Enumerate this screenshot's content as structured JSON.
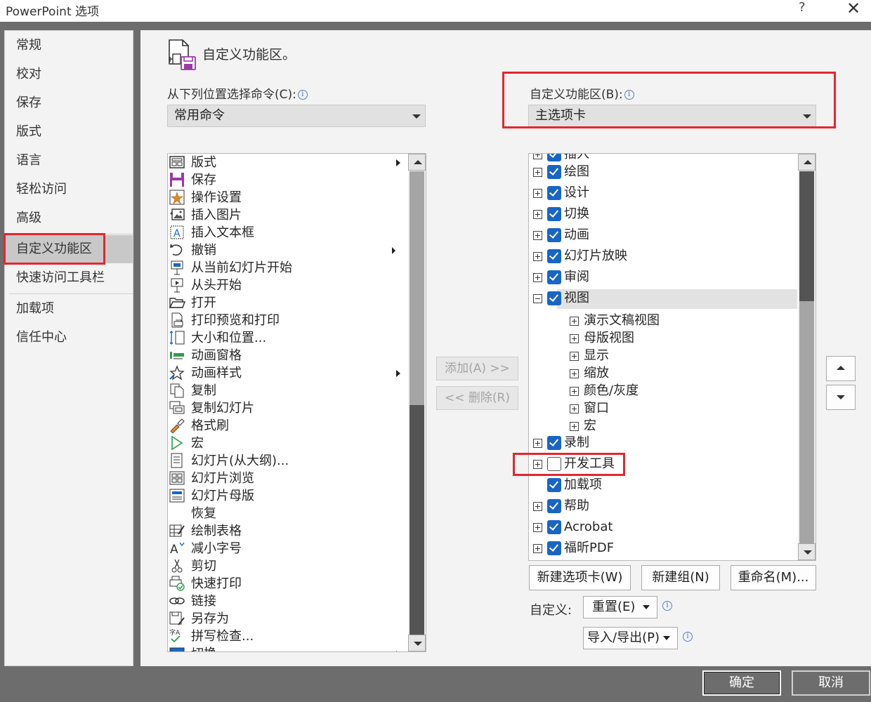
{
  "window": {
    "title": "PowerPoint 选项",
    "help": "?",
    "close": "✕"
  },
  "sidebar": {
    "items": [
      {
        "label": "常规"
      },
      {
        "label": "校对"
      },
      {
        "label": "保存"
      },
      {
        "label": "版式"
      },
      {
        "label": "语言"
      },
      {
        "label": "轻松访问"
      },
      {
        "label": "高级"
      },
      {
        "label": "自定义功能区",
        "active": true
      },
      {
        "label": "快速访问工具栏"
      },
      {
        "label": "加载项"
      },
      {
        "label": "信任中心"
      }
    ]
  },
  "main": {
    "title": "自定义功能区。",
    "choose_label": "从下列位置选择命令(C):",
    "choose_value": "常用命令",
    "customize_label": "自定义功能区(B):",
    "customize_value": "主选项卡",
    "commands": [
      {
        "label": "版式",
        "icon": "layout-icon",
        "submenu": true
      },
      {
        "label": "保存",
        "icon": "save-icon"
      },
      {
        "label": "操作设置",
        "icon": "action-star-icon"
      },
      {
        "label": "插入图片",
        "icon": "picture-icon"
      },
      {
        "label": "插入文本框",
        "icon": "textbox-icon"
      },
      {
        "label": "撤销",
        "icon": "undo-icon"
      },
      {
        "label": "从当前幻灯片开始",
        "icon": "present-current-icon"
      },
      {
        "label": "从头开始",
        "icon": "present-start-icon"
      },
      {
        "label": "打开",
        "icon": "folder-open-icon"
      },
      {
        "label": "打印预览和打印",
        "icon": "print-preview-icon"
      },
      {
        "label": "大小和位置...",
        "icon": "size-position-icon"
      },
      {
        "label": "动画窗格",
        "icon": "animation-pane-icon"
      },
      {
        "label": "动画样式",
        "icon": "animation-style-icon",
        "submenu": true
      },
      {
        "label": "复制",
        "icon": "copy-icon"
      },
      {
        "label": "复制幻灯片",
        "icon": "duplicate-slide-icon"
      },
      {
        "label": "格式刷",
        "icon": "format-painter-icon"
      },
      {
        "label": "宏",
        "icon": "macro-play-icon"
      },
      {
        "label": "幻灯片(从大纲)...",
        "icon": "outline-slides-icon"
      },
      {
        "label": "幻灯片浏览",
        "icon": "slide-sorter-icon"
      },
      {
        "label": "幻灯片母版",
        "icon": "slide-master-icon"
      },
      {
        "label": "恢复",
        "icon": "blank-icon"
      },
      {
        "label": "绘制表格",
        "icon": "draw-table-icon"
      },
      {
        "label": "减小字号",
        "icon": "decrease-font-icon"
      },
      {
        "label": "剪切",
        "icon": "scissors-icon"
      },
      {
        "label": "快速打印",
        "icon": "quick-print-icon"
      },
      {
        "label": "链接",
        "icon": "link-icon"
      },
      {
        "label": "另存为",
        "icon": "save-as-icon"
      },
      {
        "label": "拼写检查...",
        "icon": "spelling-icon"
      },
      {
        "label": "切换",
        "icon": "switch-icon"
      }
    ],
    "add_button": "添加(A) >>",
    "remove_button": "<< 删除(R)",
    "ribbon_tree": [
      {
        "label": "插入",
        "level": 0,
        "expander": "plus",
        "checked": true
      },
      {
        "label": "绘图",
        "level": 0,
        "expander": "plus",
        "checked": true
      },
      {
        "label": "设计",
        "level": 0,
        "expander": "plus",
        "checked": true
      },
      {
        "label": "切换",
        "level": 0,
        "expander": "plus",
        "checked": true
      },
      {
        "label": "动画",
        "level": 0,
        "expander": "plus",
        "checked": true
      },
      {
        "label": "幻灯片放映",
        "level": 0,
        "expander": "plus",
        "checked": true
      },
      {
        "label": "审阅",
        "level": 0,
        "expander": "plus",
        "checked": true
      },
      {
        "label": "视图",
        "level": 0,
        "expander": "minus",
        "checked": true,
        "selected": true
      },
      {
        "label": "演示文稿视图",
        "level": 1,
        "expander": "plus"
      },
      {
        "label": "母版视图",
        "level": 1,
        "expander": "plus"
      },
      {
        "label": "显示",
        "level": 1,
        "expander": "plus"
      },
      {
        "label": "缩放",
        "level": 1,
        "expander": "plus"
      },
      {
        "label": "颜色/灰度",
        "level": 1,
        "expander": "plus"
      },
      {
        "label": "窗口",
        "level": 1,
        "expander": "plus"
      },
      {
        "label": "宏",
        "level": 1,
        "expander": "plus"
      },
      {
        "label": "录制",
        "level": 0,
        "expander": "plus",
        "checked": true
      },
      {
        "label": "开发工具",
        "level": 0,
        "expander": "plus",
        "checked": false
      },
      {
        "label": "加载项",
        "level": 0,
        "expander": "none",
        "checked": true
      },
      {
        "label": "帮助",
        "level": 0,
        "expander": "plus",
        "checked": true
      },
      {
        "label": "Acrobat",
        "level": 0,
        "expander": "plus",
        "checked": true
      },
      {
        "label": "福昕PDF",
        "level": 0,
        "expander": "plus",
        "checked": true
      }
    ],
    "new_tab_button": "新建选项卡(W)",
    "new_group_button": "新建组(N)",
    "rename_button": "重命名(M)...",
    "customizations_label": "自定义:",
    "reset_button": "重置(E)",
    "import_export_button": "导入/导出(P)"
  },
  "footer": {
    "ok": "确定",
    "cancel": "取消"
  },
  "colors": {
    "highlight": "#e4262f",
    "checkbox": "#1766c6"
  }
}
